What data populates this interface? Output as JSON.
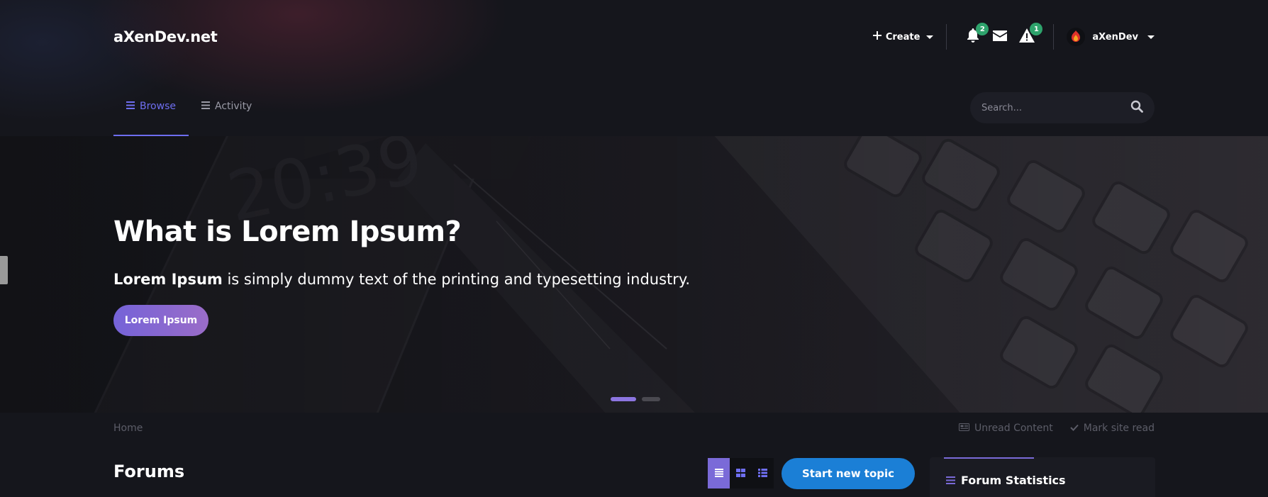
{
  "site": {
    "logo": "aXenDev.net"
  },
  "header": {
    "create_label": "Create",
    "notifications_count": "2",
    "reports_count": "1",
    "username": "aXenDev"
  },
  "nav": {
    "items": [
      {
        "label": "Browse",
        "active": true
      },
      {
        "label": "Activity",
        "active": false
      }
    ]
  },
  "search": {
    "placeholder": "Search..."
  },
  "hero": {
    "title": "What is Lorem Ipsum?",
    "text_bold": "Lorem Ipsum",
    "text_rest": " is simply dummy text of the printing and typesetting industry.",
    "button_label": "Lorem Ipsum",
    "slides": 2,
    "active_slide": 1
  },
  "breadcrumb": {
    "home": "Home",
    "unread": "Unread Content",
    "mark_read": "Mark site read"
  },
  "main": {
    "title": "Forums",
    "start_topic_label": "Start new topic",
    "view_modes": [
      "table",
      "grid",
      "fluid"
    ],
    "active_view": "table"
  },
  "sidebar": {
    "stats_title": "Forum Statistics"
  },
  "colors": {
    "accent": "#6e6ef0",
    "badge": "#2ea36c",
    "primary_button": "#1b7fd6",
    "background": "#15161c"
  }
}
